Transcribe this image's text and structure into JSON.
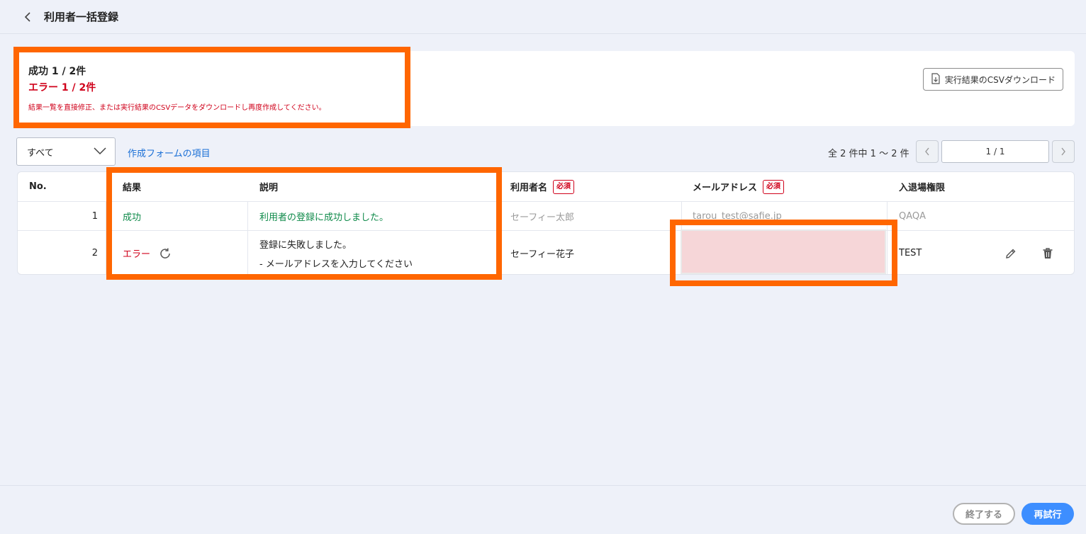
{
  "header": {
    "title": "利用者一括登録"
  },
  "summary": {
    "success": "成功 1 / 2件",
    "error": "エラー 1 / 2件",
    "note": "結果一覧を直接修正、または実行結果のCSVデータをダウンロードし再度作成してください。",
    "csv_button": "実行結果のCSVダウンロード"
  },
  "filter": {
    "selected": "すべて",
    "form_items_link": "作成フォームの項目"
  },
  "pagination": {
    "info": "全 2 件中 1 〜 2 件",
    "page": "1 / 1"
  },
  "table": {
    "headers": {
      "no": "No.",
      "result": "結果",
      "description": "説明",
      "user_name": "利用者名",
      "email": "メールアドレス",
      "access": "入退場権限",
      "required_badge": "必須"
    },
    "rows": [
      {
        "no": "1",
        "result": "成功",
        "description": "利用者の登録に成功しました。",
        "user_name": "セーフィー太郎",
        "email": "tarou_test@safie.jp",
        "access": "QAQA"
      },
      {
        "no": "2",
        "result": "エラー",
        "description_line1": "登録に失敗しました。",
        "description_line2": "- メールアドレスを入力してください",
        "user_name": "セーフィー花子",
        "email": "",
        "access": "TEST"
      }
    ]
  },
  "footer": {
    "end_button": "終了する",
    "retry_button": "再試行"
  },
  "colors": {
    "success": "#0f8a4a",
    "error": "#d0021b",
    "link": "#1a6fd6",
    "highlight": "#ff6600",
    "primary_button": "#3d8eff"
  }
}
